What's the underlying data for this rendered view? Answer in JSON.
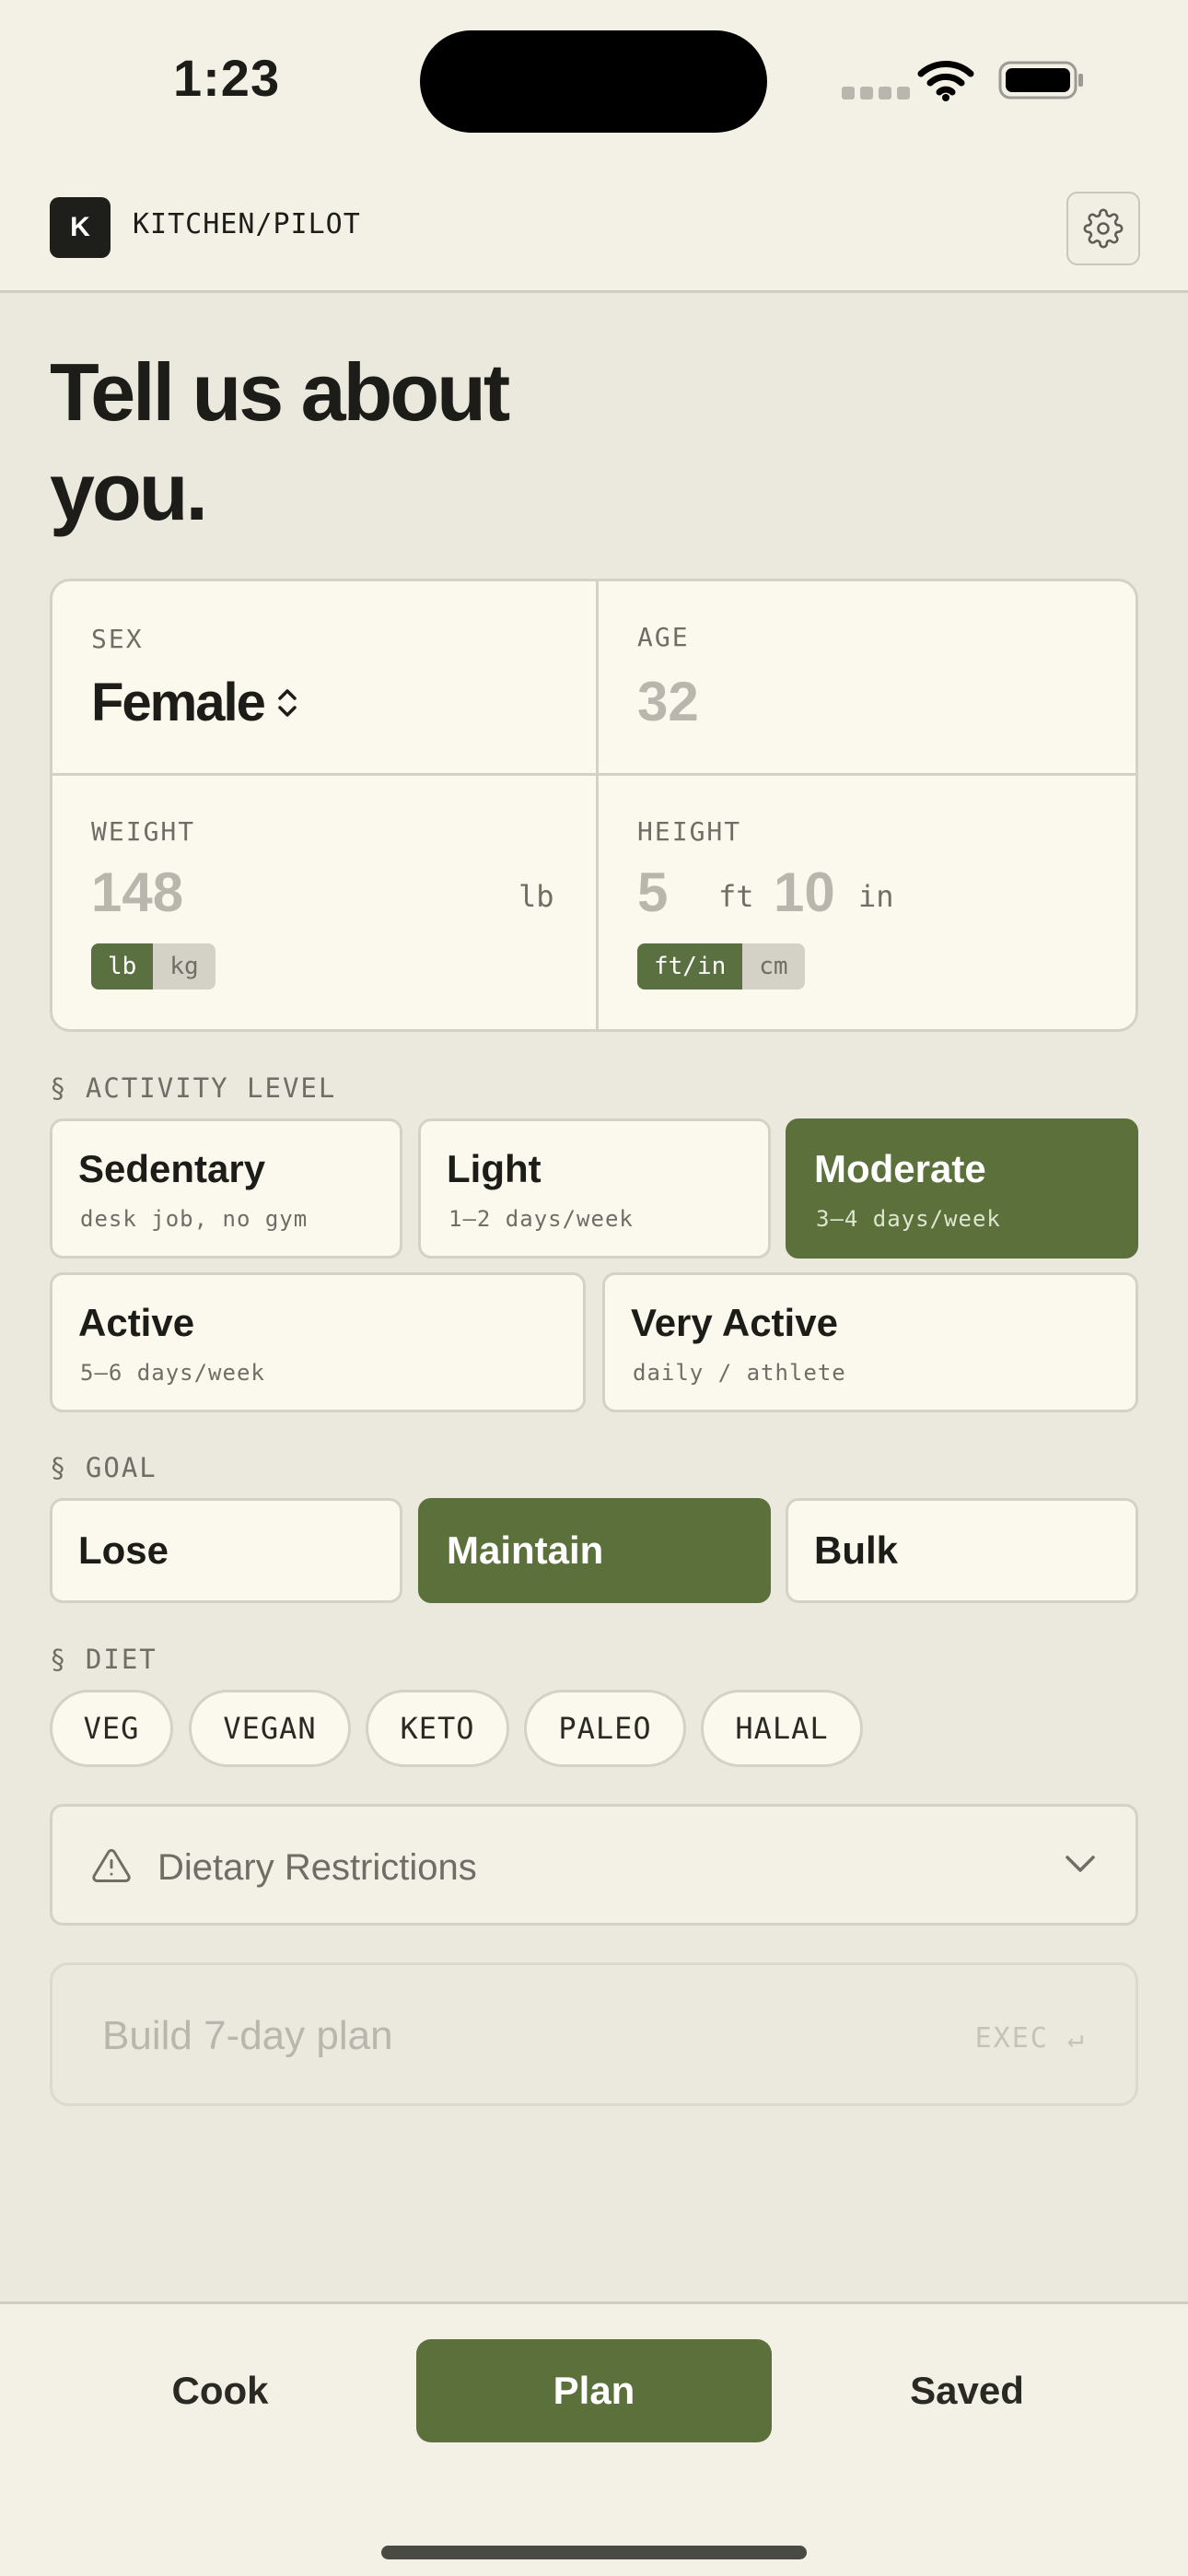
{
  "status": {
    "time": "1:23"
  },
  "header": {
    "logo_letter": "K",
    "app_name": "KITCHEN/PILOT"
  },
  "page": {
    "title": "Tell us about you."
  },
  "profile": {
    "sex": {
      "label": "SEX",
      "value": "Female"
    },
    "age": {
      "label": "AGE",
      "placeholder": "32"
    },
    "weight": {
      "label": "WEIGHT",
      "placeholder": "148",
      "unit": "lb",
      "units": [
        "lb",
        "kg"
      ],
      "selected_unit": "lb"
    },
    "height": {
      "label": "HEIGHT",
      "feet": "5",
      "feet_unit": "ft",
      "inches": "10",
      "inches_unit": "in",
      "units": [
        "ft/in",
        "cm"
      ],
      "selected_unit": "ft/in"
    }
  },
  "activity": {
    "label": "§ ACTIVITY LEVEL",
    "options": [
      {
        "title": "Sedentary",
        "subtitle": "desk job, no gym"
      },
      {
        "title": "Light",
        "subtitle": "1–2 days/week"
      },
      {
        "title": "Moderate",
        "subtitle": "3–4 days/week"
      },
      {
        "title": "Active",
        "subtitle": "5–6 days/week"
      },
      {
        "title": "Very Active",
        "subtitle": "daily / athlete"
      }
    ],
    "selected": "Moderate"
  },
  "goal": {
    "label": "§ GOAL",
    "options": [
      "Lose",
      "Maintain",
      "Bulk"
    ],
    "selected": "Maintain"
  },
  "diet": {
    "label": "§ DIET",
    "options": [
      "VEG",
      "VEGAN",
      "KETO",
      "PALEO",
      "HALAL"
    ]
  },
  "restrictions": {
    "label": "Dietary Restrictions"
  },
  "build": {
    "label": "Build 7-day plan",
    "hint": "EXEC ↵"
  },
  "tabs": [
    {
      "label": "Cook"
    },
    {
      "label": "Plan"
    },
    {
      "label": "Saved"
    }
  ],
  "active_tab": "Plan",
  "colors": {
    "accent": "#5b703b",
    "background": "#ebe8de",
    "card": "#fbf9ee"
  }
}
